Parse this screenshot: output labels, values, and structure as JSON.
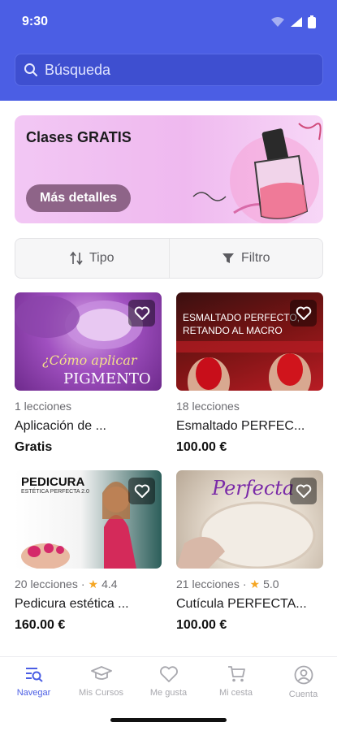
{
  "status_bar": {
    "time": "9:30"
  },
  "search": {
    "placeholder": "Búsqueda"
  },
  "banner": {
    "title": "Clases GRATIS",
    "button_label": "Más detalles"
  },
  "toolbar": {
    "sort_label": "Tipo",
    "filter_label": "Filtro"
  },
  "courses": [
    {
      "lessons": "1 lecciones",
      "rating": "",
      "title": "Aplicación de ...",
      "price": "Gratis",
      "thumb_text_1": "¿Cómo aplicar",
      "thumb_text_2": "PIGMENTO"
    },
    {
      "lessons": "18 lecciones",
      "rating": "",
      "title": "Esmaltado PERFEC...",
      "price": "100.00 €",
      "thumb_text_1": "ESMALTADO PERFECTO,",
      "thumb_text_2": "RETANDO AL MACRO"
    },
    {
      "lessons": "20 lecciones",
      "rating": "4.4",
      "title": "Pedicura estética ...",
      "price": "160.00 €",
      "thumb_text_1": "PEDICURA",
      "thumb_text_2": "ESTÉTICA PERFECTA 2.0"
    },
    {
      "lessons": "21 lecciones",
      "rating": "5.0",
      "title": "Cutícula PERFECTA...",
      "price": "100.00 €",
      "thumb_text_1": "Perfecta",
      "thumb_text_2": ""
    }
  ],
  "bottom_nav": [
    {
      "label": "Navegar",
      "icon": "browse-icon",
      "active": true
    },
    {
      "label": "Mis Cursos",
      "icon": "graduation-cap-icon",
      "active": false
    },
    {
      "label": "Me gusta",
      "icon": "heart-icon",
      "active": false
    },
    {
      "label": "Mi cesta",
      "icon": "cart-icon",
      "active": false
    },
    {
      "label": "Cuenta",
      "icon": "account-icon",
      "active": false
    }
  ],
  "colors": {
    "accent": "#4b5ee4",
    "banner": "#f2c7f4",
    "star": "#f5a623"
  }
}
